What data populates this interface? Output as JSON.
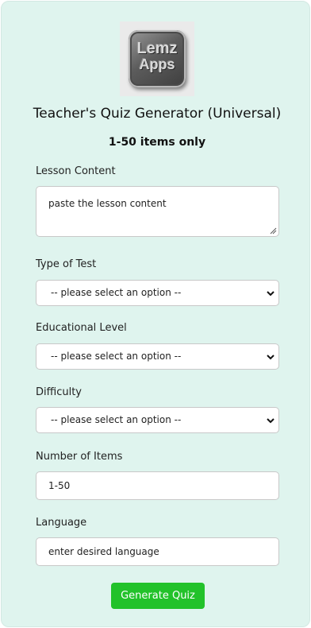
{
  "logo": {
    "line1": "Lemz",
    "line2": "Apps"
  },
  "header": {
    "title": "Teacher's Quiz Generator (Universal)",
    "subtitle": "1-50 items only"
  },
  "form": {
    "lesson_content": {
      "label": "Lesson Content",
      "placeholder": "paste the lesson content"
    },
    "type_of_test": {
      "label": "Type of Test",
      "selected": "-- please select an option --"
    },
    "educational_level": {
      "label": "Educational Level",
      "selected": "-- please select an option --"
    },
    "difficulty": {
      "label": "Difficulty",
      "selected": "-- please select an option --"
    },
    "number_of_items": {
      "label": "Number of Items",
      "placeholder": "1-50"
    },
    "language": {
      "label": "Language",
      "placeholder": "enter desired language"
    },
    "submit_label": "Generate Quiz"
  },
  "colors": {
    "card_background": "#dff4ee",
    "button_green": "#22c22a"
  }
}
